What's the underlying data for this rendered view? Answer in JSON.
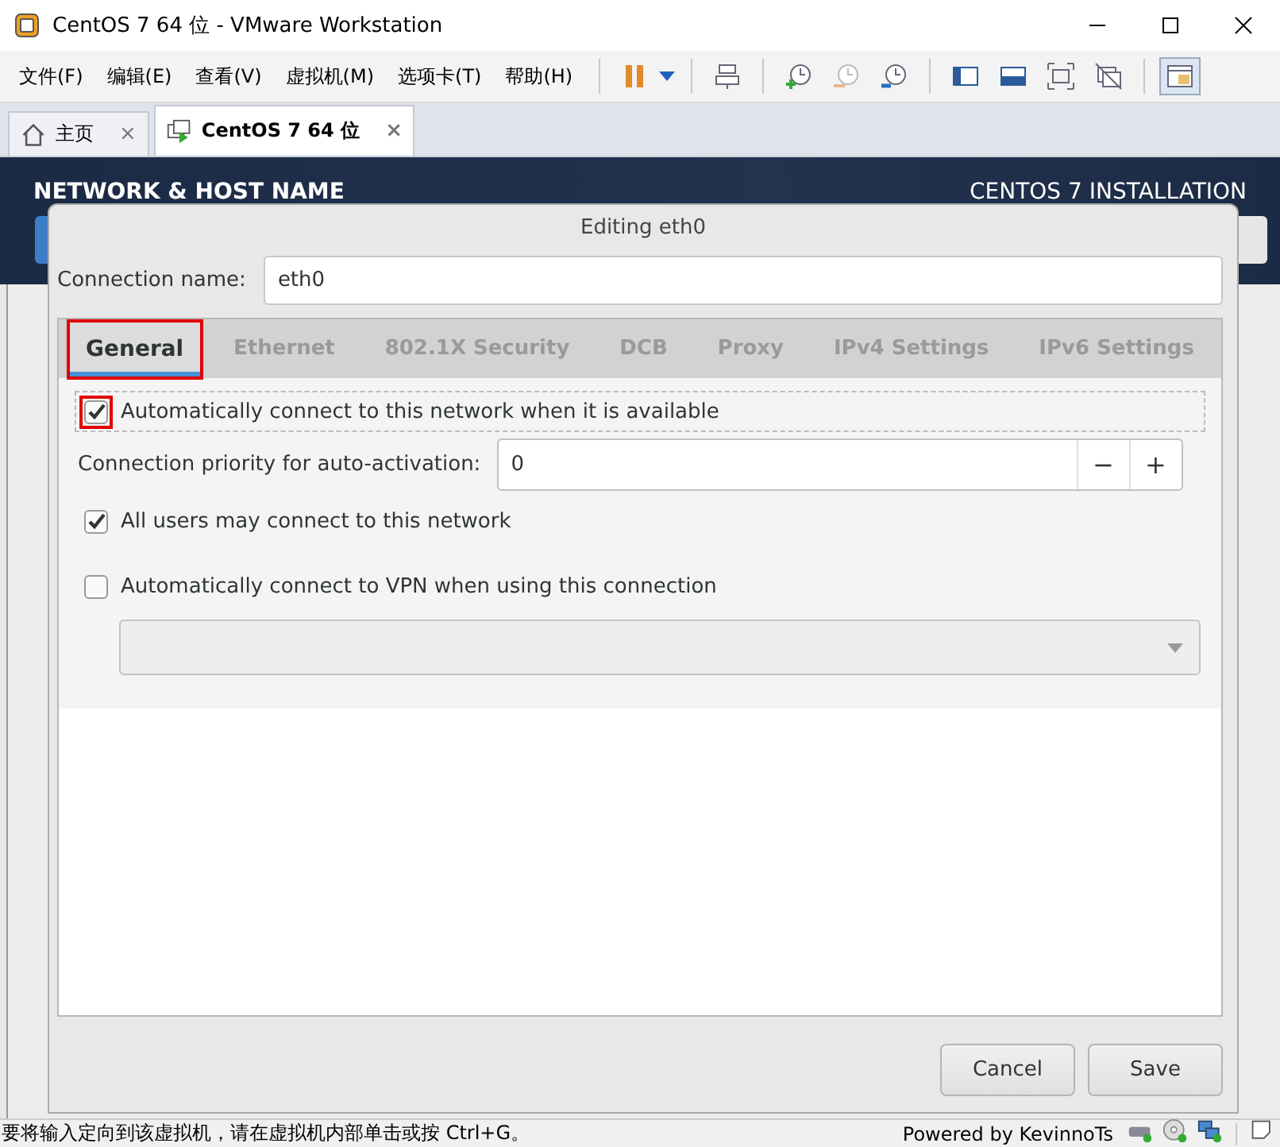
{
  "window": {
    "title": "CentOS 7 64 位 - VMware Workstation"
  },
  "menu": [
    "文件(F)",
    "编辑(E)",
    "查看(V)",
    "虚拟机(M)",
    "选项卡(T)",
    "帮助(H)"
  ],
  "tabs": [
    {
      "label": "主页",
      "selected": false,
      "close": "×"
    },
    {
      "label": "CentOS 7 64 位",
      "selected": true,
      "close": "×"
    }
  ],
  "installer": {
    "section_title": "NETWORK & HOST NAME",
    "product_title": "CENTOS 7 INSTALLATION"
  },
  "dialog": {
    "title": "Editing eth0",
    "connection_name_label": "Connection name:",
    "connection_name": "eth0",
    "tabs": [
      {
        "label": "General",
        "selected": true,
        "highlighted": true
      },
      {
        "label": "Ethernet",
        "selected": false,
        "highlighted": false
      },
      {
        "label": "802.1X Security",
        "selected": false,
        "highlighted": false
      },
      {
        "label": "DCB",
        "selected": false,
        "highlighted": false
      },
      {
        "label": "Proxy",
        "selected": false,
        "highlighted": false
      },
      {
        "label": "IPv4 Settings",
        "selected": false,
        "highlighted": false
      },
      {
        "label": "IPv6 Settings",
        "selected": false,
        "highlighted": false
      }
    ],
    "options": [
      {
        "kind": "checkbox",
        "label": "Automatically connect to this network when it is available",
        "checked": true,
        "highlighted": true,
        "focused": true
      },
      {
        "kind": "spin",
        "label": "Connection priority for auto-activation:",
        "value": "0",
        "minus": "−",
        "plus": "+"
      },
      {
        "kind": "checkbox",
        "label": "All users may connect to this network",
        "checked": true,
        "highlighted": false,
        "focused": false
      },
      {
        "kind": "checkbox",
        "label": "Automatically connect to VPN when using this connection",
        "checked": false,
        "highlighted": false,
        "focused": false
      },
      {
        "kind": "dropdown"
      }
    ],
    "buttons": [
      "Cancel",
      "Save"
    ]
  },
  "status_bar": {
    "message": "要将输入定向到该虚拟机，请在虚拟机内部单击或按 Ctrl+G。",
    "credit": "Powered by KevinnoTs"
  }
}
